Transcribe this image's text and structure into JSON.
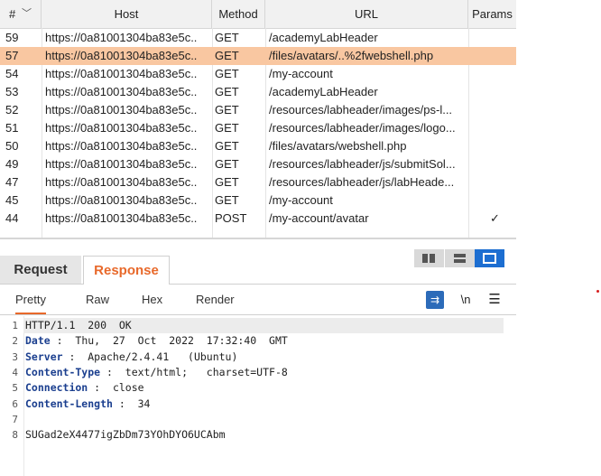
{
  "table": {
    "headers": {
      "num": "#",
      "host": "Host",
      "method": "Method",
      "url": "URL",
      "params": "Params"
    },
    "rows": [
      {
        "num": "59",
        "host": "https://0a81001304ba83e5c..",
        "method": "GET",
        "url": "/academyLabHeader",
        "params": ""
      },
      {
        "num": "57",
        "host": "https://0a81001304ba83e5c..",
        "method": "GET",
        "url": "/files/avatars/..%2fwebshell.php",
        "params": ""
      },
      {
        "num": "54",
        "host": "https://0a81001304ba83e5c..",
        "method": "GET",
        "url": "/my-account",
        "params": ""
      },
      {
        "num": "53",
        "host": "https://0a81001304ba83e5c..",
        "method": "GET",
        "url": "/academyLabHeader",
        "params": ""
      },
      {
        "num": "52",
        "host": "https://0a81001304ba83e5c..",
        "method": "GET",
        "url": "/resources/labheader/images/ps-l...",
        "params": ""
      },
      {
        "num": "51",
        "host": "https://0a81001304ba83e5c..",
        "method": "GET",
        "url": "/resources/labheader/images/logo...",
        "params": ""
      },
      {
        "num": "50",
        "host": "https://0a81001304ba83e5c..",
        "method": "GET",
        "url": "/files/avatars/webshell.php",
        "params": ""
      },
      {
        "num": "49",
        "host": "https://0a81001304ba83e5c..",
        "method": "GET",
        "url": "/resources/labheader/js/submitSol...",
        "params": ""
      },
      {
        "num": "47",
        "host": "https://0a81001304ba83e5c..",
        "method": "GET",
        "url": "/resources/labheader/js/labHeade...",
        "params": ""
      },
      {
        "num": "45",
        "host": "https://0a81001304ba83e5c..",
        "method": "GET",
        "url": "/my-account",
        "params": ""
      },
      {
        "num": "44",
        "host": "https://0a81001304ba83e5c..",
        "method": "POST",
        "url": "/my-account/avatar",
        "params": "✓"
      }
    ],
    "highlight_color": "#f9c7a1"
  },
  "tabs": {
    "request": "Request",
    "response": "Response"
  },
  "subtabs": {
    "pretty": "Pretty",
    "raw": "Raw",
    "hex": "Hex",
    "render": "Render"
  },
  "tools": {
    "wrap": "⇉",
    "newline": "\\n",
    "menu": "☰"
  },
  "lines": [
    {
      "n": "1",
      "key": "",
      "text": "HTTP/1.1  200  OK"
    },
    {
      "n": "2",
      "key": "Date",
      "text": " :  Thu,  27  Oct  2022  17:32:40  GMT"
    },
    {
      "n": "3",
      "key": "Server",
      "text": " :  Apache/2.4.41   (Ubuntu)"
    },
    {
      "n": "4",
      "key": "Content-Type",
      "text": " :  text/html;   charset=UTF-8"
    },
    {
      "n": "5",
      "key": "Connection",
      "text": " :  close"
    },
    {
      "n": "6",
      "key": "Content-Length",
      "text": " :  34"
    },
    {
      "n": "7",
      "key": "",
      "text": ""
    },
    {
      "n": "8",
      "key": "",
      "text": "SUGad2eX4477igZbDm73YOhDYO6UCAbm"
    }
  ],
  "colors": {
    "accent": "#e8692b",
    "active_layout": "#1c6ed1"
  }
}
